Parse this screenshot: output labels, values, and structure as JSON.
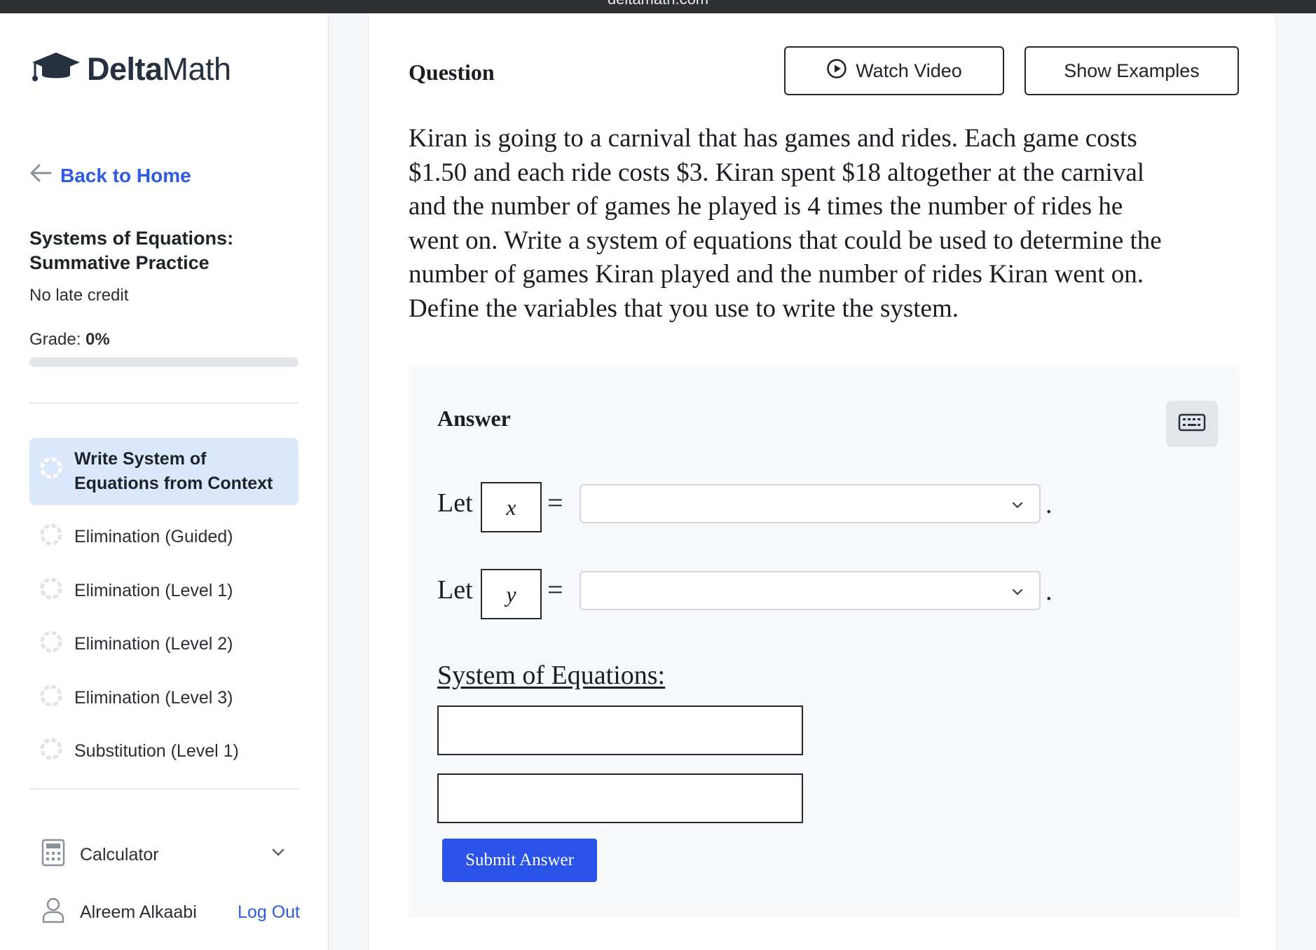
{
  "browser": {
    "url": "deltamath.com"
  },
  "brand": {
    "name_bold": "Delta",
    "name_regular": "Math"
  },
  "sidebar": {
    "back_label": "Back to Home",
    "assignment_title": "Systems of Equations: Summative Practice",
    "late_credit": "No late credit",
    "grade_label": "Grade:",
    "grade_value": "0%",
    "grade_progress": 0,
    "skills": [
      {
        "label": "Write System of Equations from Context",
        "active": true
      },
      {
        "label": "Elimination (Guided)",
        "active": false
      },
      {
        "label": "Elimination (Level 1)",
        "active": false
      },
      {
        "label": "Elimination (Level 2)",
        "active": false
      },
      {
        "label": "Elimination (Level 3)",
        "active": false
      },
      {
        "label": "Substitution (Level 1)",
        "active": false
      }
    ],
    "calculator_label": "Calculator",
    "user_name": "Alreem Alkaabi",
    "logout_label": "Log Out"
  },
  "main": {
    "question_heading": "Question",
    "watch_video_label": "Watch Video",
    "show_examples_label": "Show Examples",
    "question_text": "Kiran is going to a carnival that has games and rides. Each game costs\n$1.50 and each ride costs $3. Kiran spent $18 altogether at the carnival\nand the number of games he played is 4 times the number of rides he\nwent on. Write a system of equations that could be used to determine the\nnumber of games Kiran played and the number of rides Kiran went on.\nDefine the variables that you use to write the system.",
    "answer_heading": "Answer",
    "let_word": "Let",
    "variables": [
      {
        "symbol": "x",
        "equals": "=",
        "selected": "",
        "period": "."
      },
      {
        "symbol": "y",
        "equals": "=",
        "selected": "",
        "period": "."
      }
    ],
    "system_label": "System of Equations:",
    "equation_inputs": [
      "",
      ""
    ],
    "submit_label": "Submit Answer"
  },
  "icons": {
    "logo": "graduation-cap-icon",
    "back": "arrow-left-icon",
    "skill_status": "progress-ring-icon",
    "video": "play-circle-icon",
    "keyboard": "keyboard-icon",
    "dropdown": "chevron-down-icon",
    "calculator": "calculator-icon",
    "user": "user-icon"
  },
  "colors": {
    "accent": "#2d5be3",
    "submit": "#2b52e8",
    "active_skill_bg": "#dbe8fc",
    "brand_text": "#253041"
  }
}
